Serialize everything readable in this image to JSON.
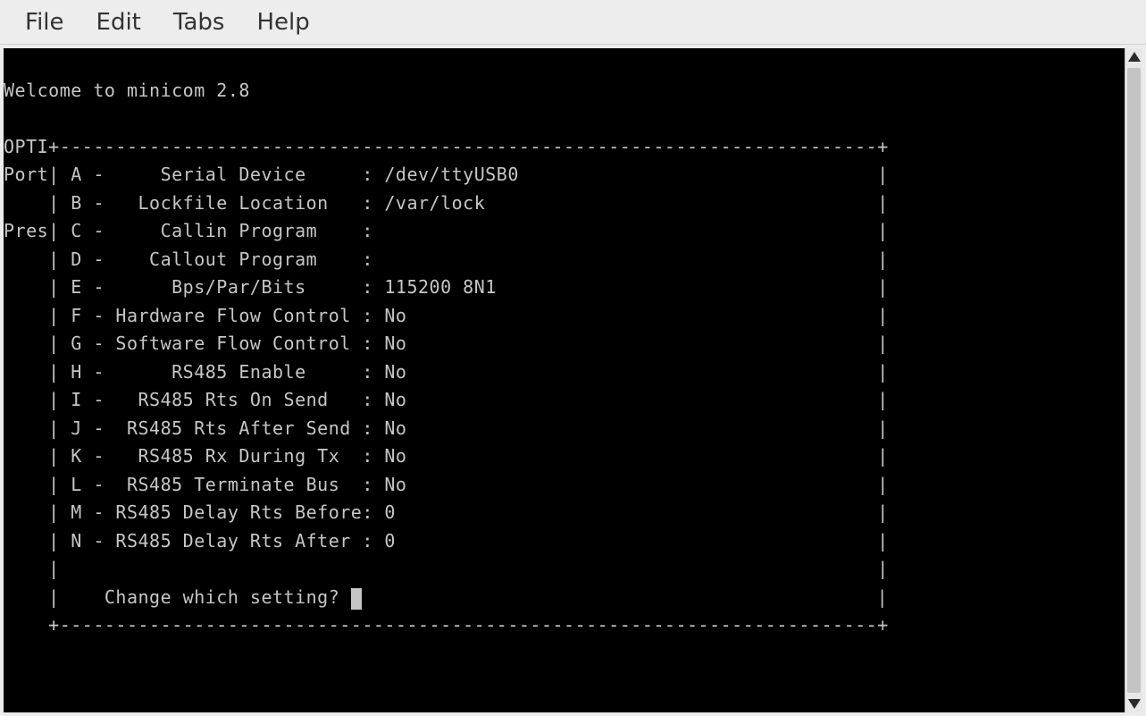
{
  "menubar": {
    "file": "File",
    "edit": "Edit",
    "tabs": "Tabs",
    "help": "Help"
  },
  "terminal": {
    "welcome": "Welcome to minicom 2.8",
    "left_labels": {
      "opti": "OPTI",
      "port": "Port",
      "pres": "Pres"
    },
    "settings": [
      {
        "key": "A",
        "label": "Serial Device",
        "value": "/dev/ttyUSB0"
      },
      {
        "key": "B",
        "label": "Lockfile Location",
        "value": "/var/lock"
      },
      {
        "key": "C",
        "label": "Callin Program",
        "value": ""
      },
      {
        "key": "D",
        "label": "Callout Program",
        "value": ""
      },
      {
        "key": "E",
        "label": "Bps/Par/Bits",
        "value": "115200 8N1"
      },
      {
        "key": "F",
        "label": "Hardware Flow Control",
        "value": "No"
      },
      {
        "key": "G",
        "label": "Software Flow Control",
        "value": "No"
      },
      {
        "key": "H",
        "label": "RS485 Enable",
        "value": "No"
      },
      {
        "key": "I",
        "label": "RS485 Rts On Send",
        "value": "No"
      },
      {
        "key": "J",
        "label": "RS485 Rts After Send",
        "value": "No"
      },
      {
        "key": "K",
        "label": "RS485 Rx During Tx",
        "value": "No"
      },
      {
        "key": "L",
        "label": "RS485 Terminate Bus",
        "value": "No"
      },
      {
        "key": "M",
        "label": "RS485 Delay Rts Before",
        "value": "0"
      },
      {
        "key": "N",
        "label": "RS485 Delay Rts After",
        "value": "0"
      }
    ],
    "prompt": "Change which setting?",
    "box_inner_width": 73
  }
}
